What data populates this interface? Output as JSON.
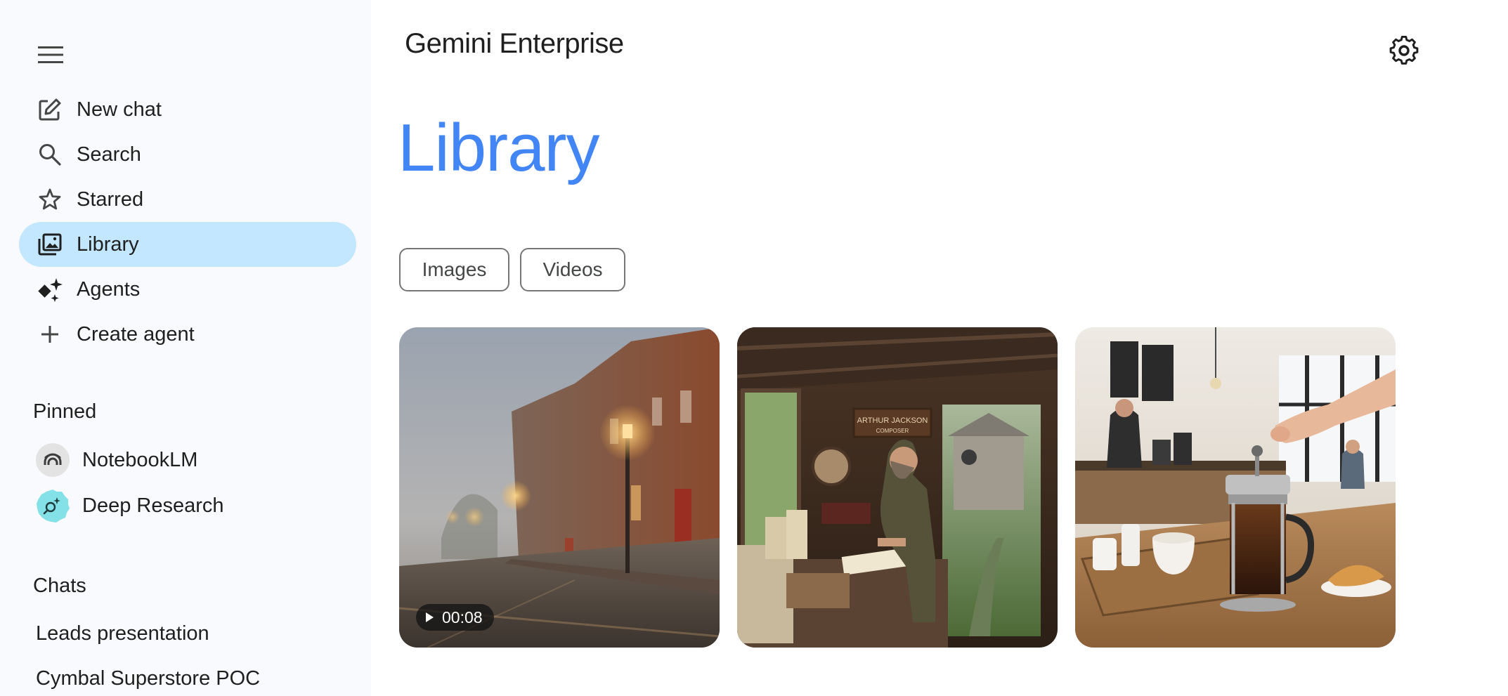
{
  "app": {
    "title": "Gemini Enterprise"
  },
  "sidebar": {
    "nav": [
      {
        "label": "New chat",
        "icon": "edit-icon"
      },
      {
        "label": "Search",
        "icon": "search-icon"
      },
      {
        "label": "Starred",
        "icon": "star-icon"
      },
      {
        "label": "Library",
        "icon": "library-icon",
        "active": true
      },
      {
        "label": "Agents",
        "icon": "sparkle-icon"
      },
      {
        "label": "Create agent",
        "icon": "plus-icon"
      }
    ],
    "pinned_title": "Pinned",
    "pinned": [
      {
        "label": "NotebookLM",
        "icon": "notebooklm-icon"
      },
      {
        "label": "Deep Research",
        "icon": "deep-research-icon"
      }
    ],
    "chats_title": "Chats",
    "chats": [
      {
        "label": "Leads presentation"
      },
      {
        "label": "Cymbal Superstore POC"
      }
    ]
  },
  "main": {
    "page_title": "Library",
    "filters": [
      {
        "label": "Images"
      },
      {
        "label": "Videos"
      }
    ],
    "media": [
      {
        "kind": "video",
        "duration": "00:08",
        "subject": "foggy cobblestone street at dusk"
      },
      {
        "kind": "image",
        "subject": "composer in a wooden shed",
        "sign_line1": "ARTHUR JACKSON",
        "sign_line2": "COMPOSER"
      },
      {
        "kind": "image",
        "subject": "french press coffee in a cafe"
      }
    ]
  },
  "colors": {
    "accent": "#4285f4",
    "active_nav": "#c2e7ff",
    "sidebar_bg": "#f8fafd"
  }
}
